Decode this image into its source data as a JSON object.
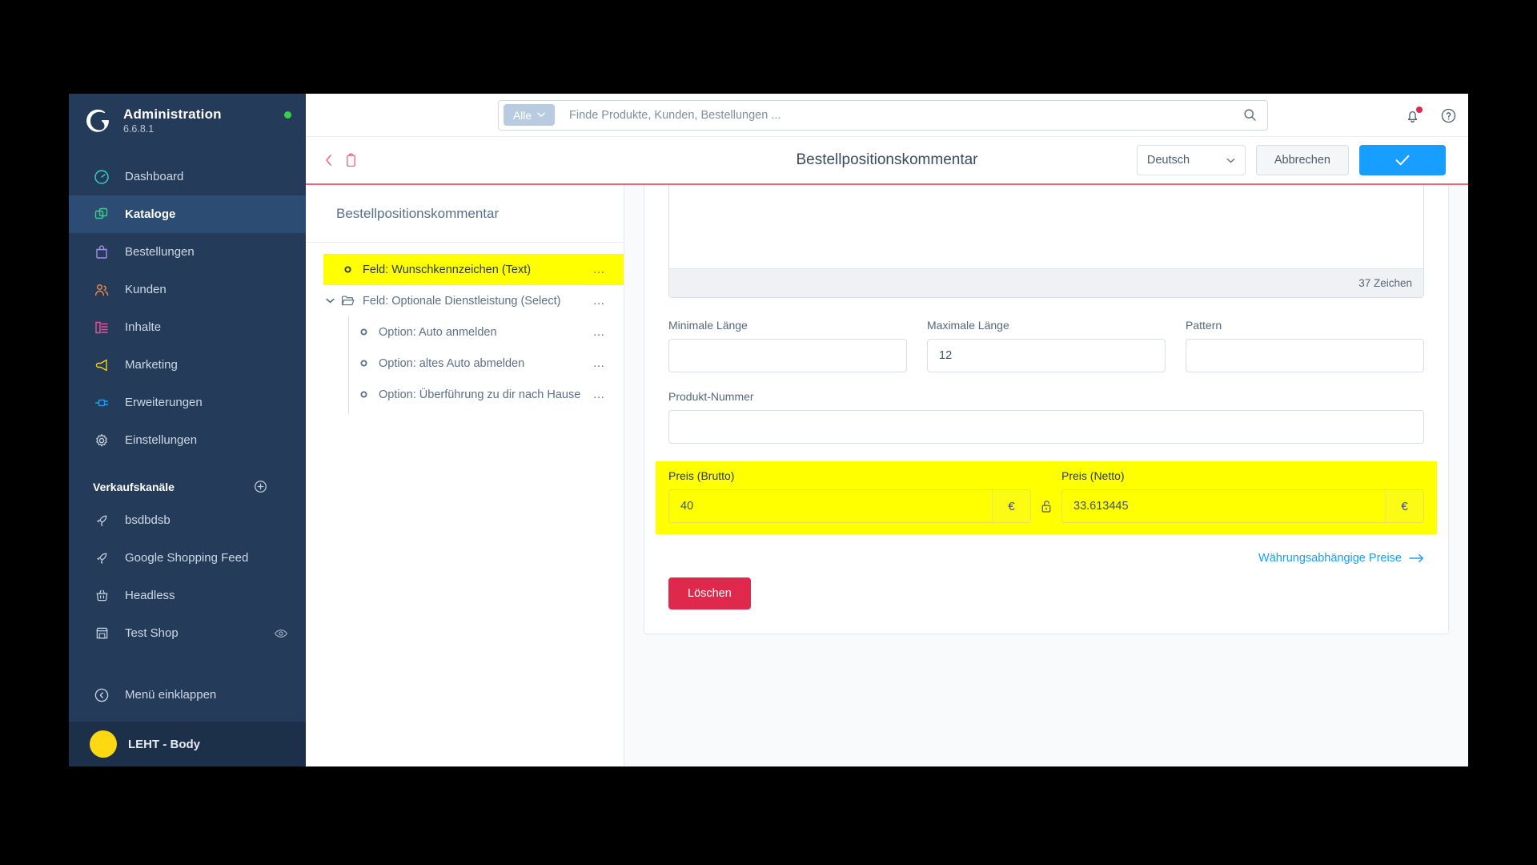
{
  "sidebar": {
    "brand": {
      "title": "Administration",
      "version": "6.6.8.1",
      "status_dot_color": "#37d046"
    },
    "items": [
      {
        "label": "Dashboard",
        "icon": "dashboard-icon",
        "color": "#37d1ca",
        "active": false
      },
      {
        "label": "Kataloge",
        "icon": "catalog-icon",
        "color": "#3ecf8e",
        "active": true
      },
      {
        "label": "Bestellungen",
        "icon": "orders-bag-icon",
        "color": "#a48bf0",
        "active": false
      },
      {
        "label": "Kunden",
        "icon": "customers-icon",
        "color": "#f08a4b",
        "active": false
      },
      {
        "label": "Inhalte",
        "icon": "content-icon",
        "color": "#ee4f9b",
        "active": false
      },
      {
        "label": "Marketing",
        "icon": "megaphone-icon",
        "color": "#f5d311",
        "active": false
      },
      {
        "label": "Erweiterungen",
        "icon": "plug-icon",
        "color": "#189eff",
        "active": false
      },
      {
        "label": "Einstellungen",
        "icon": "gear-icon",
        "color": "#c5d0dc",
        "active": false
      }
    ],
    "sales_channels_title": "Verkaufskanäle",
    "sales_channels_add": "+",
    "sales_channels": [
      {
        "label": "bsdbdsb",
        "icon": "rocket-icon",
        "trailing": ""
      },
      {
        "label": "Google Shopping Feed",
        "icon": "rocket-icon",
        "trailing": ""
      },
      {
        "label": "Headless",
        "icon": "basket-icon",
        "trailing": ""
      },
      {
        "label": "Test Shop",
        "icon": "storefront-icon",
        "trailing": "eye-icon"
      }
    ],
    "collapse": {
      "label": "Menü einklappen",
      "icon": "chevron-circle-left-icon"
    },
    "bottom_user": {
      "label": "LEHT - Body",
      "avatar_color": "#ffd814"
    }
  },
  "topbar": {
    "scope_label": "Alle",
    "search_placeholder": "Finde Produkte, Kunden, Bestellungen ...",
    "search_value": "",
    "search_icon": "magnifier-icon",
    "notification_icon": "bell-icon",
    "help_icon": "question-circle-icon",
    "has_notification": true
  },
  "header": {
    "back_icon": "chevron-left-icon",
    "context_icon": "clipboard-icon",
    "title": "Bestellpositionskommentar",
    "language": "Deutsch",
    "cancel_label": "Abbrechen",
    "save_icon": "check-icon",
    "save_color": "#189eff",
    "accent_underline": "#f0637e"
  },
  "tree": {
    "heading": "Bestellpositionskommentar",
    "rows": [
      {
        "label": "Feld: Wunschkennzeichen (Text)",
        "level": 0,
        "icon": "option-dot-icon",
        "expandable": false,
        "highlighted": true,
        "menu": "…"
      },
      {
        "label": "Feld: Optionale Dienstleistung (Select)",
        "level": 0,
        "icon": "folder-open-icon",
        "expandable": true,
        "highlighted": false,
        "menu": "…"
      },
      {
        "label": "Option: Auto anmelden",
        "level": 1,
        "icon": "option-dot-icon",
        "expandable": false,
        "highlighted": false,
        "menu": "…"
      },
      {
        "label": "Option: altes Auto abmelden",
        "level": 1,
        "icon": "option-dot-icon",
        "expandable": false,
        "highlighted": false,
        "menu": "…"
      },
      {
        "label": "Option: Überführung zu dir nach Hause",
        "level": 1,
        "icon": "option-dot-icon",
        "expandable": false,
        "highlighted": false,
        "menu": "…"
      }
    ]
  },
  "detail": {
    "textarea_value": "",
    "char_counter": "37 Zeichen",
    "fields": [
      {
        "label": "Minimale Länge",
        "value": ""
      },
      {
        "label": "Maximale Länge",
        "value": "12"
      },
      {
        "label": "Pattern",
        "value": ""
      }
    ],
    "product_number": {
      "label": "Produkt-Nummer",
      "value": ""
    },
    "price_gross": {
      "label": "Preis (Brutto)",
      "value": "40",
      "currency": "€"
    },
    "price_net": {
      "label": "Preis (Netto)",
      "value": "33.613445",
      "currency": "€"
    },
    "lock_icon": "unlock-icon",
    "currency_link": {
      "label": "Währungsabhängige Preise",
      "icon": "arrow-right-icon"
    },
    "delete_label": "Löschen",
    "delete_color": "#de294c",
    "highlight_color": "#ffff00"
  }
}
